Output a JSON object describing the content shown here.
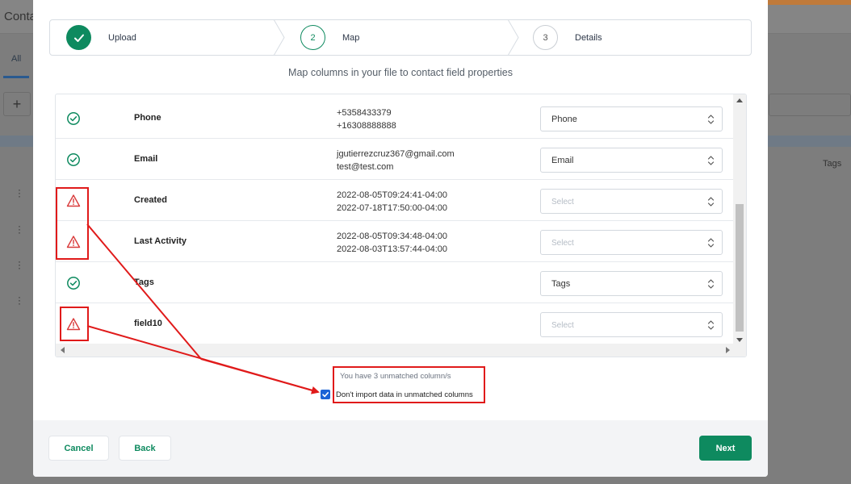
{
  "background": {
    "title": "Conta",
    "tab_all": "All",
    "plus": "+",
    "tags_header": "Tags"
  },
  "stepper": {
    "steps": [
      {
        "number": "",
        "label": "Upload",
        "state": "done"
      },
      {
        "number": "2",
        "label": "Map",
        "state": "active"
      },
      {
        "number": "3",
        "label": "Details",
        "state": "pending"
      }
    ]
  },
  "subtitle": "Map columns in your file to contact field properties",
  "rows": [
    {
      "name": "Phone",
      "samples": [
        "+5358433379",
        "+16308888888"
      ],
      "status": "matched",
      "select": "Phone",
      "placeholder": false
    },
    {
      "name": "Email",
      "samples": [
        "jgutierrezcruz367@gmail.com",
        "test@test.com"
      ],
      "status": "matched",
      "select": "Email",
      "placeholder": false
    },
    {
      "name": "Created",
      "samples": [
        "2022-08-05T09:24:41-04:00",
        "2022-07-18T17:50:00-04:00"
      ],
      "status": "unmatched",
      "select": "Select",
      "placeholder": true
    },
    {
      "name": "Last Activity",
      "samples": [
        "2022-08-05T09:34:48-04:00",
        "2022-08-03T13:57:44-04:00"
      ],
      "status": "unmatched",
      "select": "Select",
      "placeholder": true
    },
    {
      "name": "Tags",
      "samples": [
        "",
        ""
      ],
      "status": "matched",
      "select": "Tags",
      "placeholder": false
    },
    {
      "name": "field10",
      "samples": [
        "",
        ""
      ],
      "status": "unmatched",
      "select": "Select",
      "placeholder": true
    }
  ],
  "notice": {
    "unmatched_text": "You have 3 unmatched column/s",
    "checkbox_label": "Don't import data in unmatched columns",
    "checked": true
  },
  "footer": {
    "cancel": "Cancel",
    "back": "Back",
    "next": "Next"
  },
  "colors": {
    "primary": "#0e8a5f",
    "warning": "#d93a3a",
    "annotation": "#e01a1a",
    "checkbox": "#1a62d6"
  }
}
